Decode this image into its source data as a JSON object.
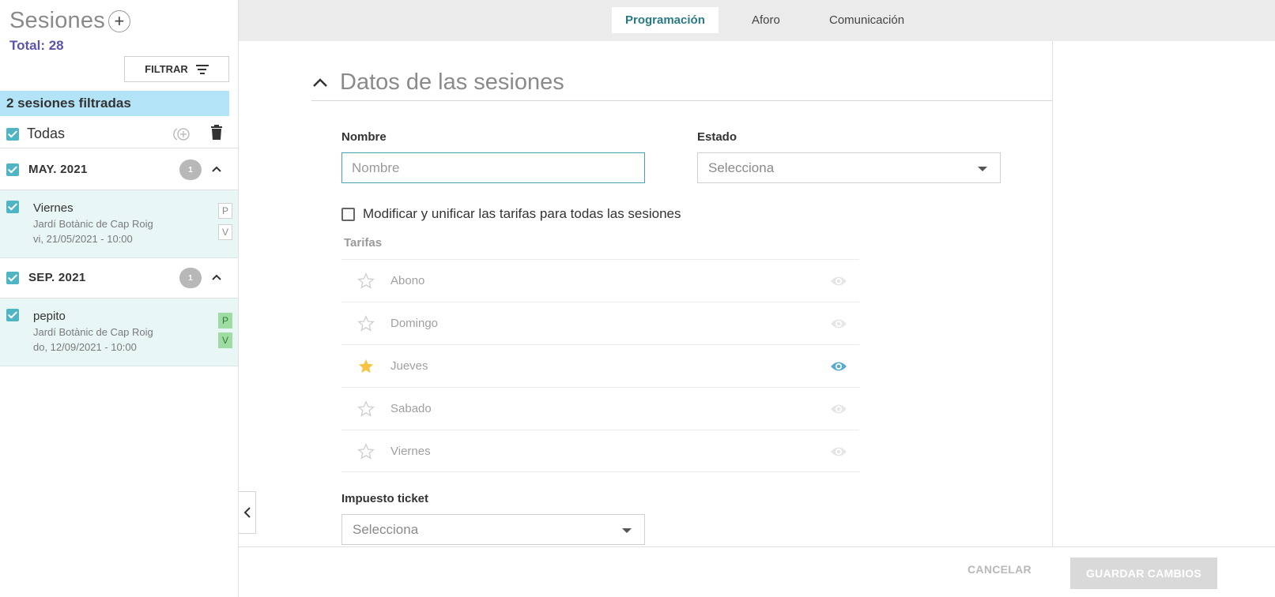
{
  "sidebar": {
    "title": "Sesiones",
    "add_icon": "plus-circle-icon",
    "total": "Total: 28",
    "filter_label": "FILTRAR",
    "filtered_text": "2 sesiones filtradas",
    "select_all_label": "Todas",
    "groups": [
      {
        "month": "MAY. 2021",
        "count": "1",
        "sessions": [
          {
            "name": "Viernes",
            "place": "Jardí Botànic de Cap Roig",
            "date": "vi, 21/05/2021 - 10:00",
            "tags": [
              "P",
              "V"
            ],
            "tags_active": false
          }
        ]
      },
      {
        "month": "SEP. 2021",
        "count": "1",
        "sessions": [
          {
            "name": "pepito",
            "place": "Jardí Botànic de Cap Roig",
            "date": "do, 12/09/2021 - 10:00",
            "tags": [
              "P",
              "V"
            ],
            "tags_active": true
          }
        ]
      }
    ]
  },
  "tabs": [
    {
      "label": "Programación",
      "active": true
    },
    {
      "label": "Aforo",
      "active": false
    },
    {
      "label": "Comunicación",
      "active": false
    }
  ],
  "main": {
    "section_title": "Datos de las sesiones",
    "nombre_label": "Nombre",
    "nombre_placeholder": "Nombre",
    "nombre_value": "",
    "estado_label": "Estado",
    "estado_value": "Selecciona",
    "unify_label": "Modificar y unificar las tarifas para todas las sesiones",
    "unify_checked": false,
    "tarifas_label": "Tarifas",
    "tarifas": [
      {
        "name": "Abono",
        "favorite": false,
        "visible": false
      },
      {
        "name": "Domingo",
        "favorite": false,
        "visible": false
      },
      {
        "name": "Jueves",
        "favorite": true,
        "visible": true
      },
      {
        "name": "Sabado",
        "favorite": false,
        "visible": false
      },
      {
        "name": "Viernes",
        "favorite": false,
        "visible": false
      }
    ],
    "impuesto_label": "Impuesto ticket",
    "impuesto_value": "Selecciona"
  },
  "footer": {
    "cancel_label": "CANCELAR",
    "save_label": "GUARDAR CAMBIOS"
  },
  "colors": {
    "accent": "#4fb5c4",
    "active_tab_text": "#2a7a85",
    "filtered_banner": "#b3e3f7",
    "total_text": "#5a55a8",
    "star_active": "#f5c542",
    "eye_active": "#5aaad0"
  }
}
